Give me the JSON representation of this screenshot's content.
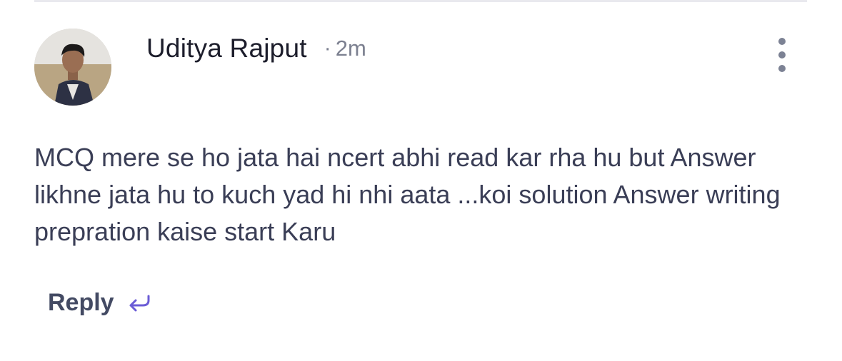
{
  "comment": {
    "author": {
      "name": "Uditya Rajput",
      "avatar_icon": "profile-photo"
    },
    "separator": "·",
    "timestamp": "2m",
    "menu_icon": "more-vertical-icon",
    "body": "MCQ mere se ho jata hai ncert abhi read kar rha hu but Answer likhne jata hu to kuch yad hi nhi aata ...koi solution Answer writing prepration kaise start Karu",
    "reply": {
      "label": "Reply",
      "icon": "reply-arrow-icon"
    }
  },
  "colors": {
    "author_text": "#1c1d2b",
    "meta_text": "#7c8090",
    "body_text": "#3a3e56",
    "reply_text": "#434a63",
    "reply_icon": "#6b5cd6",
    "divider": "#e9e9ee"
  }
}
